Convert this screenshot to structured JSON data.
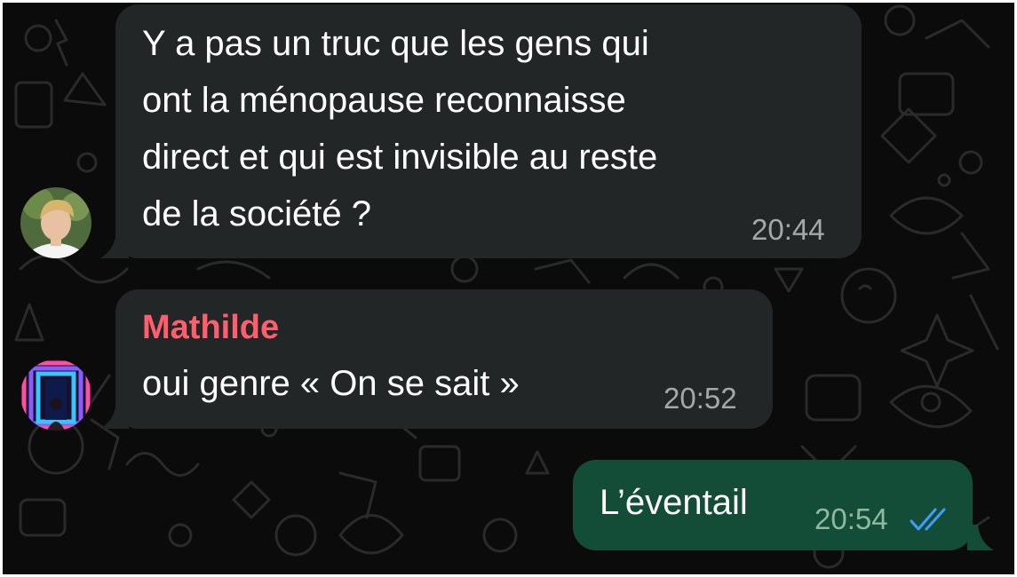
{
  "messages": [
    {
      "direction": "incoming",
      "sender": "",
      "avatar": "avatar-blond-young-man",
      "lines": [
        "Y a pas un truc que les gens qui",
        "ont la ménopause reconnaisse",
        "direct et qui est invisible au reste",
        "de la société ?"
      ],
      "time": "20:44"
    },
    {
      "direction": "incoming",
      "sender": "Mathilde",
      "sender_color": "#ff5e6c",
      "avatar": "avatar-neon-tunnel",
      "lines": [
        "oui genre « On se sait »"
      ],
      "time": "20:52"
    },
    {
      "direction": "outgoing",
      "lines": [
        "L’éventail"
      ],
      "time": "20:54",
      "status": "double-check-icon",
      "status_color": "#3f9dff"
    }
  ],
  "theme": {
    "chat_background": "#0b0b0b",
    "incoming_bubble": "#232627",
    "outgoing_bubble": "#144d37"
  }
}
